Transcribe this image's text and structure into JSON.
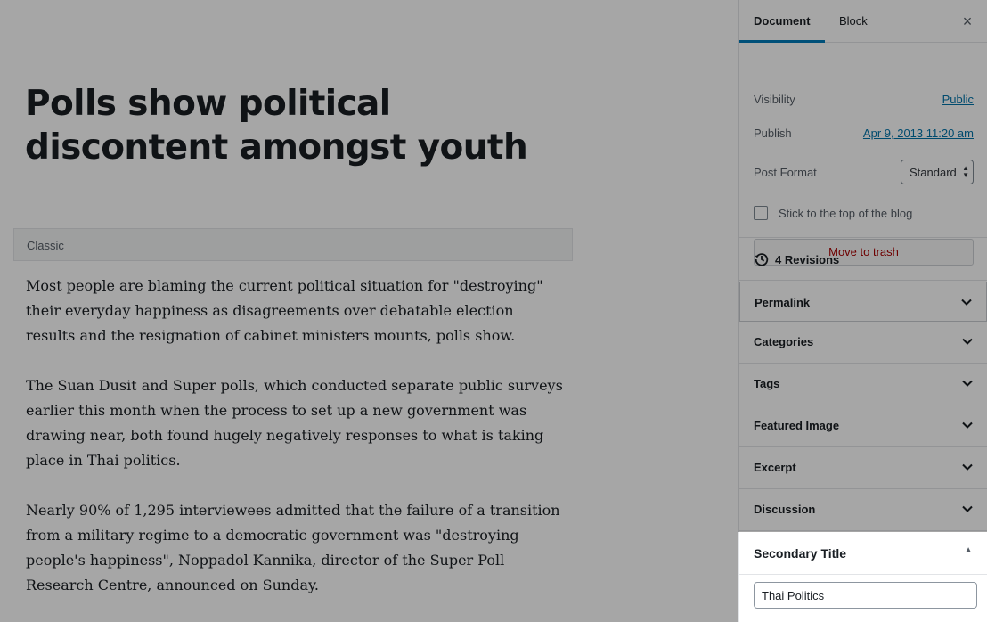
{
  "editor": {
    "title": "Polls show political discontent amongst youth",
    "classic_label": "Classic",
    "paragraphs": [
      "Most people are blaming the current political situation for \"destroying\" their everyday happiness as disagreements over debatable election results and the resignation of cabinet ministers mounts, polls show.",
      "The Suan Dusit and Super polls, which conducted separate public surveys earlier this month when the process to set up a new government was drawing near, both found hugely negatively responses to what is taking place in Thai politics.",
      "Nearly 90% of 1,295 interviewees admitted that the failure of a transition from a military regime to a democratic government was \"destroying people's happiness\", Noppadol Kannika, director of the Super Poll Research Centre, announced on Sunday."
    ]
  },
  "sidebar": {
    "tabs": {
      "document": "Document",
      "block": "Block"
    },
    "close_icon": "×",
    "visibility": {
      "label": "Visibility",
      "value": "Public"
    },
    "publish": {
      "label": "Publish",
      "value": "Apr 9, 2013 11:20 am"
    },
    "post_format": {
      "label": "Post Format",
      "value": "Standard"
    },
    "sticky": {
      "label": "Stick to the top of the blog",
      "checked": false
    },
    "trash_label": "Move to trash",
    "revisions_label": "4 Revisions",
    "panels": {
      "permalink": "Permalink",
      "categories": "Categories",
      "tags": "Tags",
      "featured_image": "Featured Image",
      "excerpt": "Excerpt",
      "discussion": "Discussion"
    },
    "secondary_title": {
      "heading": "Secondary Title",
      "input_value": "Thai Politics"
    }
  },
  "colors": {
    "link": "#0073aa",
    "tab_active": "#007cba",
    "trash": "#aa0000",
    "overlay": "rgba(0,0,0,0.35)"
  }
}
